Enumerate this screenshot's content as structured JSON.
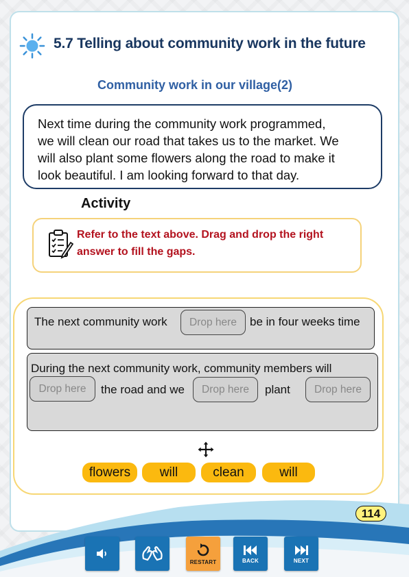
{
  "header": {
    "title": "5.7 Telling about community work in the future",
    "icon": "sun-icon"
  },
  "subtitle": "Community work in our village(2)",
  "passage": {
    "lines": [
      "Next time during the community work programmed,",
      "we will clean our road that takes us to the market. We",
      "will also plant some flowers along the road to make it",
      "look beautiful. I am looking forward to that day."
    ]
  },
  "activity": {
    "heading": "Activity",
    "instruction_lines": [
      "Refer to the text above. Drag and drop the right",
      "answer to fill the gaps."
    ],
    "instruction_icon": "clipboard-checklist-icon"
  },
  "sentences": {
    "s1": {
      "before": "The next community work",
      "drop": "Drop here",
      "after": "be in four weeks time"
    },
    "s2": {
      "line1": "During the next community work, community members will",
      "drop1": "Drop here",
      "mid1": "the road and we",
      "drop2": "Drop here",
      "mid2": "plant",
      "drop3": "Drop here"
    }
  },
  "options": [
    "flowers",
    "will",
    "clean",
    "will"
  ],
  "page_number": "114",
  "nav": {
    "audio_icon": "speaker-icon",
    "sign_icon": "sign-language-icon",
    "restart_label": "RESTART",
    "back_label": "BACK",
    "next_label": "NEXT"
  },
  "colors": {
    "title": "#18365f",
    "subtitle": "#2f5fa3",
    "instruction": "#b3121e",
    "chip": "#fbb90f",
    "nav_button": "#1a73b4",
    "restart_button": "#f5a03c"
  }
}
